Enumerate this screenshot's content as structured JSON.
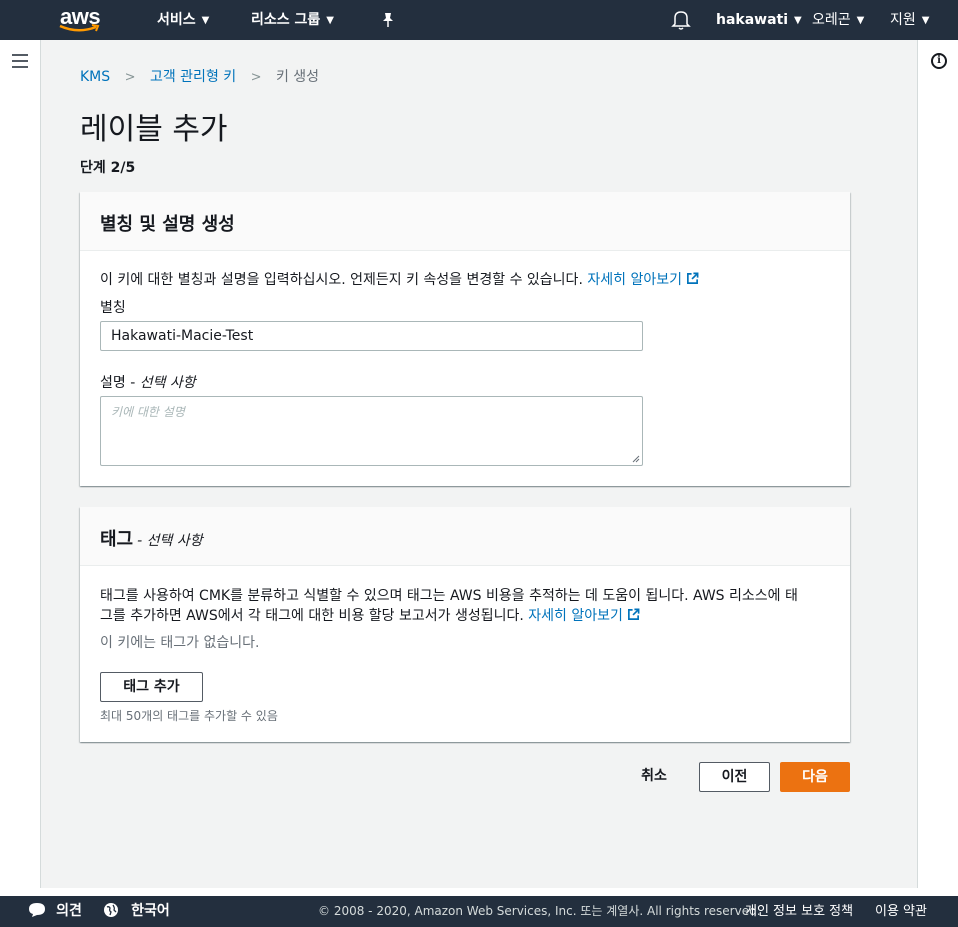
{
  "nav": {
    "logo": "aws",
    "services": "서비스",
    "resource_groups": "리소스 그룹",
    "user": "hakawati",
    "region": "오레곤",
    "support": "지원"
  },
  "breadcrumb": {
    "kms": "KMS",
    "cmk": "고객 관리형 키",
    "current": "키 생성"
  },
  "page": {
    "title": "레이블 추가",
    "step": "단계 2/5"
  },
  "alias_panel": {
    "title": "별칭 및 설명 생성",
    "description": "이 키에 대한 별칭과 설명을 입력하십시오. 언제든지 키 속성을 변경할 수 있습니다.",
    "learn_more": "자세히 알아보기",
    "alias_label": "별칭",
    "alias_value": "Hakawati-Macie-Test",
    "desc_label": "설명 -",
    "desc_optional": "선택 사항",
    "desc_placeholder": "키에 대한 설명"
  },
  "tags_panel": {
    "title": "태그",
    "optional": "- 선택 사항",
    "description_line1": "태그를 사용하여 CMK를 분류하고 식별할 수 있으며 태그는 AWS 비용을 추적하는 데 도움이 됩니다. AWS 리소스에 태",
    "description_line2": "그를 추가하면 AWS에서 각 태그에 대한 비용 할당 보고서가 생성됩니다.",
    "learn_more": "자세히 알아보기",
    "no_tags": "이 키에는 태그가 없습니다.",
    "add_tag": "태그 추가",
    "limit_hint": "최대 50개의 태그를 추가할 수 있음"
  },
  "actions": {
    "cancel": "취소",
    "previous": "이전",
    "next": "다음"
  },
  "footer": {
    "feedback": "의견",
    "language": "한국어",
    "copyright": "© 2008 - 2020, Amazon Web Services, Inc. 또는 계열사. All rights reserved.",
    "privacy": "개인 정보 보호 정책",
    "terms": "이용 약관"
  },
  "colors": {
    "nav_bg": "#232f3e",
    "link": "#0073bb",
    "primary": "#ec7211",
    "page_bg": "#f2f3f3"
  }
}
